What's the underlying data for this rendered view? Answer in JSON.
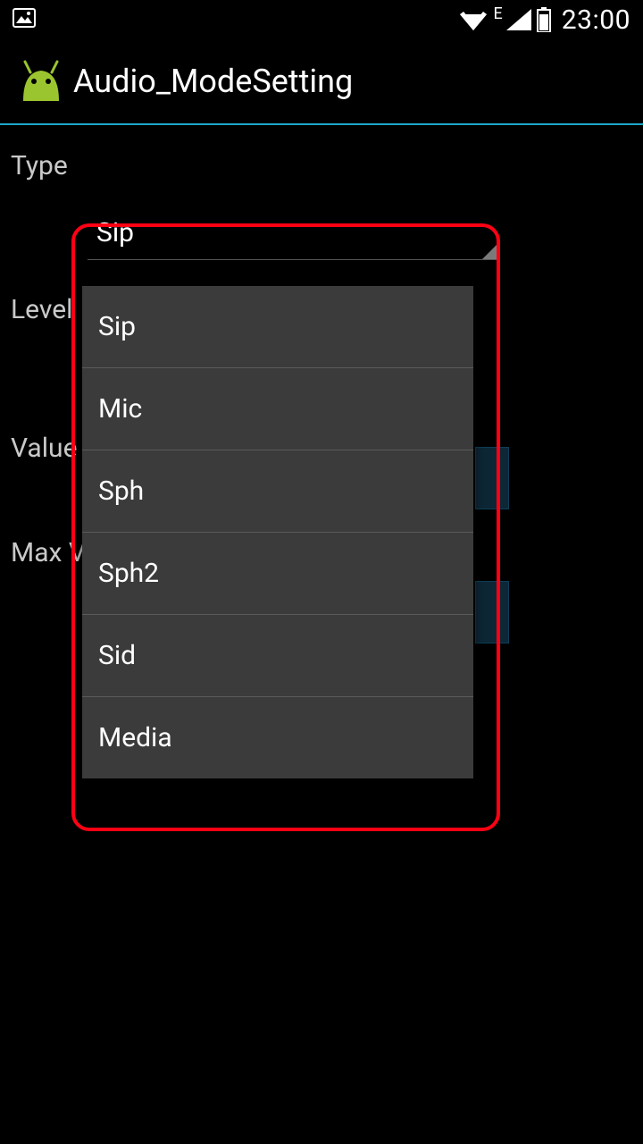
{
  "statusbar": {
    "network_letter": "E",
    "time": "23:00"
  },
  "appbar": {
    "title": "Audio_ModeSetting"
  },
  "labels": {
    "type": "Type",
    "level": "Level",
    "value": "Value",
    "maxv": "Max V"
  },
  "type_spinner": {
    "selected": "Sip",
    "options": [
      "Sip",
      "Mic",
      "Sph",
      "Sph2",
      "Sid",
      "Media"
    ]
  }
}
